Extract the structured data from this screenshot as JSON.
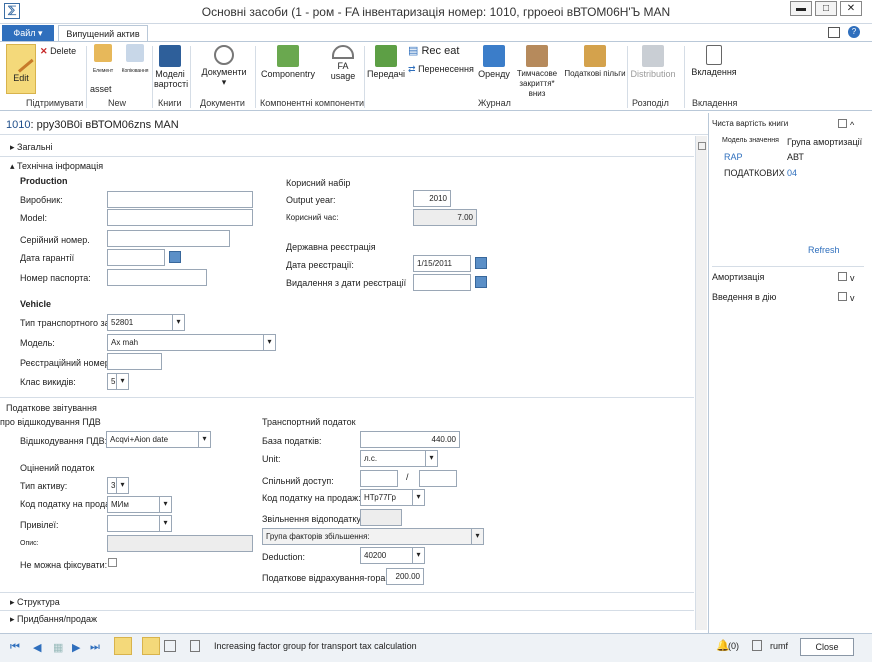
{
  "window": {
    "title": "Основні засоби (1 - ром - FA інвентаризація номер: 1010, грроеоі вВТОМ06Н'Ъ MAN",
    "min": "▬",
    "max": "□",
    "close": "✕"
  },
  "tabs": {
    "file": "Файл ▾",
    "asset": "Випущений актив"
  },
  "ribbon": {
    "edit": "Edit",
    "delete": "Delete",
    "new_small1": "Елемент",
    "new_small2": "Копіювання",
    "asset_label": "asset",
    "new_group": "New",
    "edit_group": "Підтримувати",
    "models": "Моделі вартості",
    "books_group": "Книги",
    "documents": "Документи",
    "documents_group": "Документи",
    "components": "Componentry",
    "fa_usage": "FA usage",
    "components_group": "Компонентні компоненти",
    "transfers": "Передачі",
    "rec_eat": "Rec eat",
    "transfer_title": "Перенесення",
    "leases": "Оренду",
    "temporary": "Тимчасове закриття* вниз",
    "tax_benefits": "Податкові пільги",
    "journal_group": "Журнал",
    "distribution": "Distribution",
    "distribution_group": "Розподіл",
    "attachments": "Вкладення",
    "attachments_group": "Вкладення"
  },
  "header": {
    "id": "1010",
    "text": ": рру30В0і вВТОМ06zns MAN"
  },
  "sections": {
    "general": "Загальні",
    "technical": "Технічна інформація",
    "structure": "Структура",
    "acquisition": "Придбання/продаж"
  },
  "production": {
    "title": "Production",
    "manufacturer": "Виробник:",
    "model": "Model:",
    "serial": "Серійний номер.",
    "warranty": "Дата гарантії",
    "passport": "Номер паспорта:"
  },
  "useful": {
    "title": "Корисний набір",
    "output_year_label": "Output year:",
    "output_year": "2010",
    "life_label": "Корисний час:",
    "life": "7.00"
  },
  "registration": {
    "title": "Державна реєстрація",
    "date_label": "Дата реєстрації:",
    "date": "1/15/2011",
    "removal_label": "Видалення з дати реєстрації"
  },
  "vehicle": {
    "title": "Vehicle",
    "type_label": "Тип транспортного засобу",
    "type": "52801",
    "model_label": "Модель:",
    "model": "Ax mah",
    "reg_label": "Реєстраційний номер:",
    "class_label": "Клас викидів:",
    "class": "5"
  },
  "tax": {
    "title": "Податкове звітування",
    "vat_title": "про відшкодування ПДВ",
    "vat_label": "Відшкодування ПДВ:",
    "vat": "Acqvi+Aion date",
    "assessed_title": "Оцінений податок",
    "asset_type_label": "Тип активу:",
    "asset_type": "3",
    "tax_code_label": "Код податку на продаж:",
    "tax_code": "МИм",
    "privilege_label": "Привілеї:",
    "desc_label": "Опис:",
    "cannot_fix_label": "Не можна фіксувати:"
  },
  "transport": {
    "title": "Транспортний податок",
    "base_label": "База податків:",
    "base": "440.00",
    "unit_label": "Unit:",
    "unit": "л.с.",
    "shared_label": "Спільний доступ:",
    "slash": "/",
    "tax_code_label": "Код податку на продаж:",
    "tax_code": "НТр77Гр",
    "exempt_label": "Звільнення відоподаткування:",
    "factor_label": "Група факторів збільшення:",
    "deduction_label": "Deduction:",
    "deduction": "40200",
    "credit_label": "Податкове відрахування-гора:",
    "credit": "200.00"
  },
  "factbox": {
    "title": "Чиста вартість книги",
    "col1": "Модель значення",
    "col2": "Група амортизації",
    "row1c1": "RAP",
    "row1c2": "АВТ",
    "row2c1": "ПОДАТКОВИХ",
    "row2c2": "04",
    "refresh": "Refresh",
    "depreciation": "Амортизація",
    "commissioning": "Введення в дію"
  },
  "status": {
    "message": "Increasing factor group for transport tax calculation",
    "alerts": "(0)",
    "user": "rumf",
    "close": "Close"
  }
}
